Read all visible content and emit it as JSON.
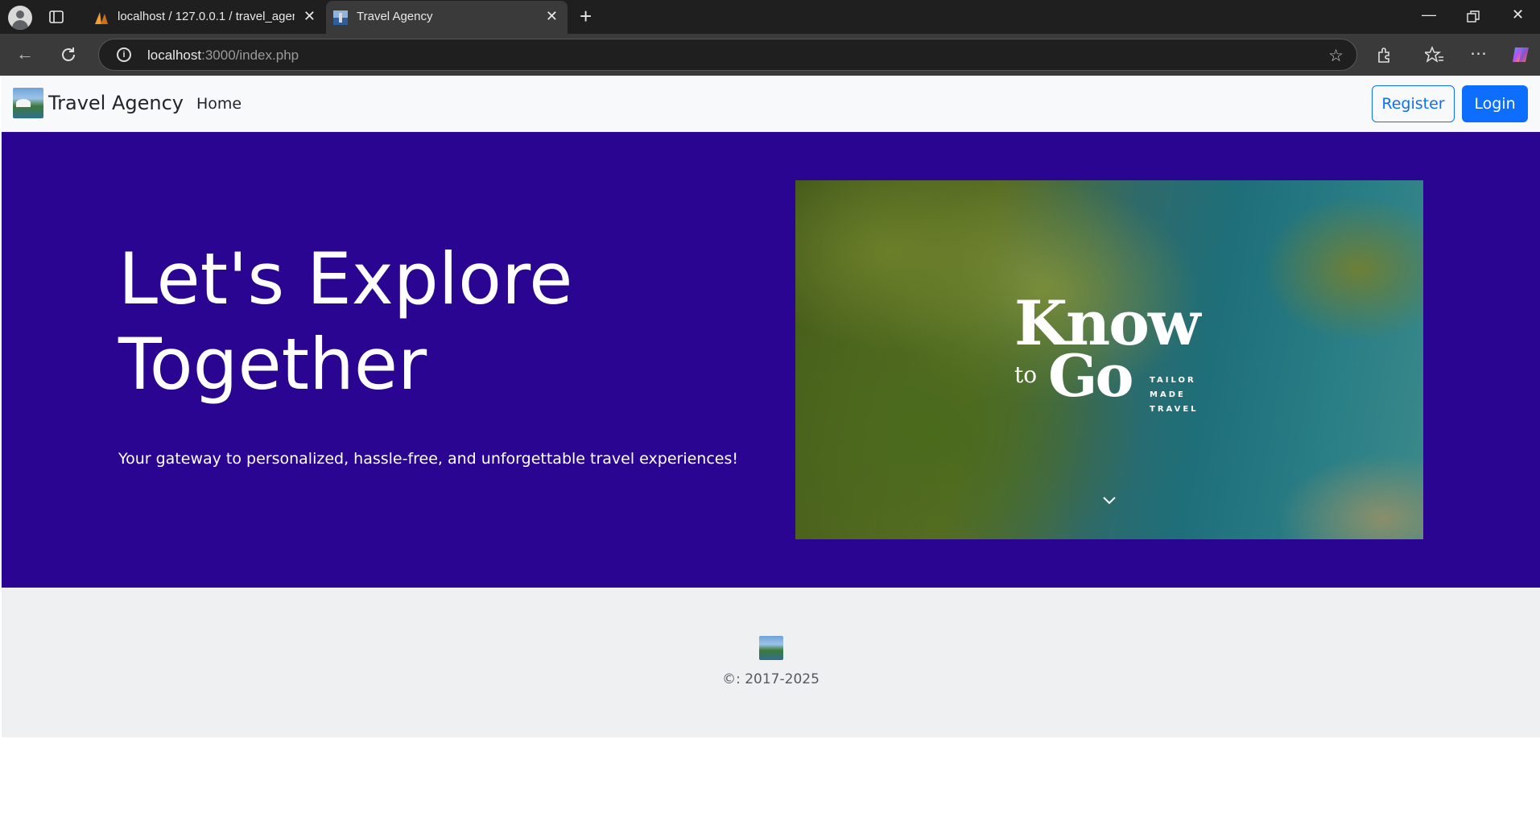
{
  "browser": {
    "tabs": [
      {
        "title": "localhost / 127.0.0.1 / travel_agen",
        "active": false,
        "icon": "phpmyadmin-icon"
      },
      {
        "title": "Travel Agency",
        "active": true,
        "icon": "site-favicon"
      }
    ],
    "url_host": "localhost",
    "url_rest": ":3000/index.php"
  },
  "nav": {
    "brand": "Travel Agency",
    "home": "Home",
    "register": "Register",
    "login": "Login"
  },
  "hero": {
    "title_line1": "Let's Explore",
    "title_line2": "Together",
    "subtitle": "Your gateway to personalized, hassle-free, and unforgettable travel experiences!",
    "image_logo": {
      "know": "Know",
      "to": "to",
      "go": "Go",
      "tag_line1": "TAILOR",
      "tag_line2": "MADE",
      "tag_line3": "TRAVEL"
    },
    "background_color": "#2a0592"
  },
  "footer": {
    "copyright": "©: 2017-2025"
  },
  "colors": {
    "primary": "#0d6efd",
    "navbar_bg": "#f8f9fa",
    "footer_bg": "#eff0f2"
  }
}
